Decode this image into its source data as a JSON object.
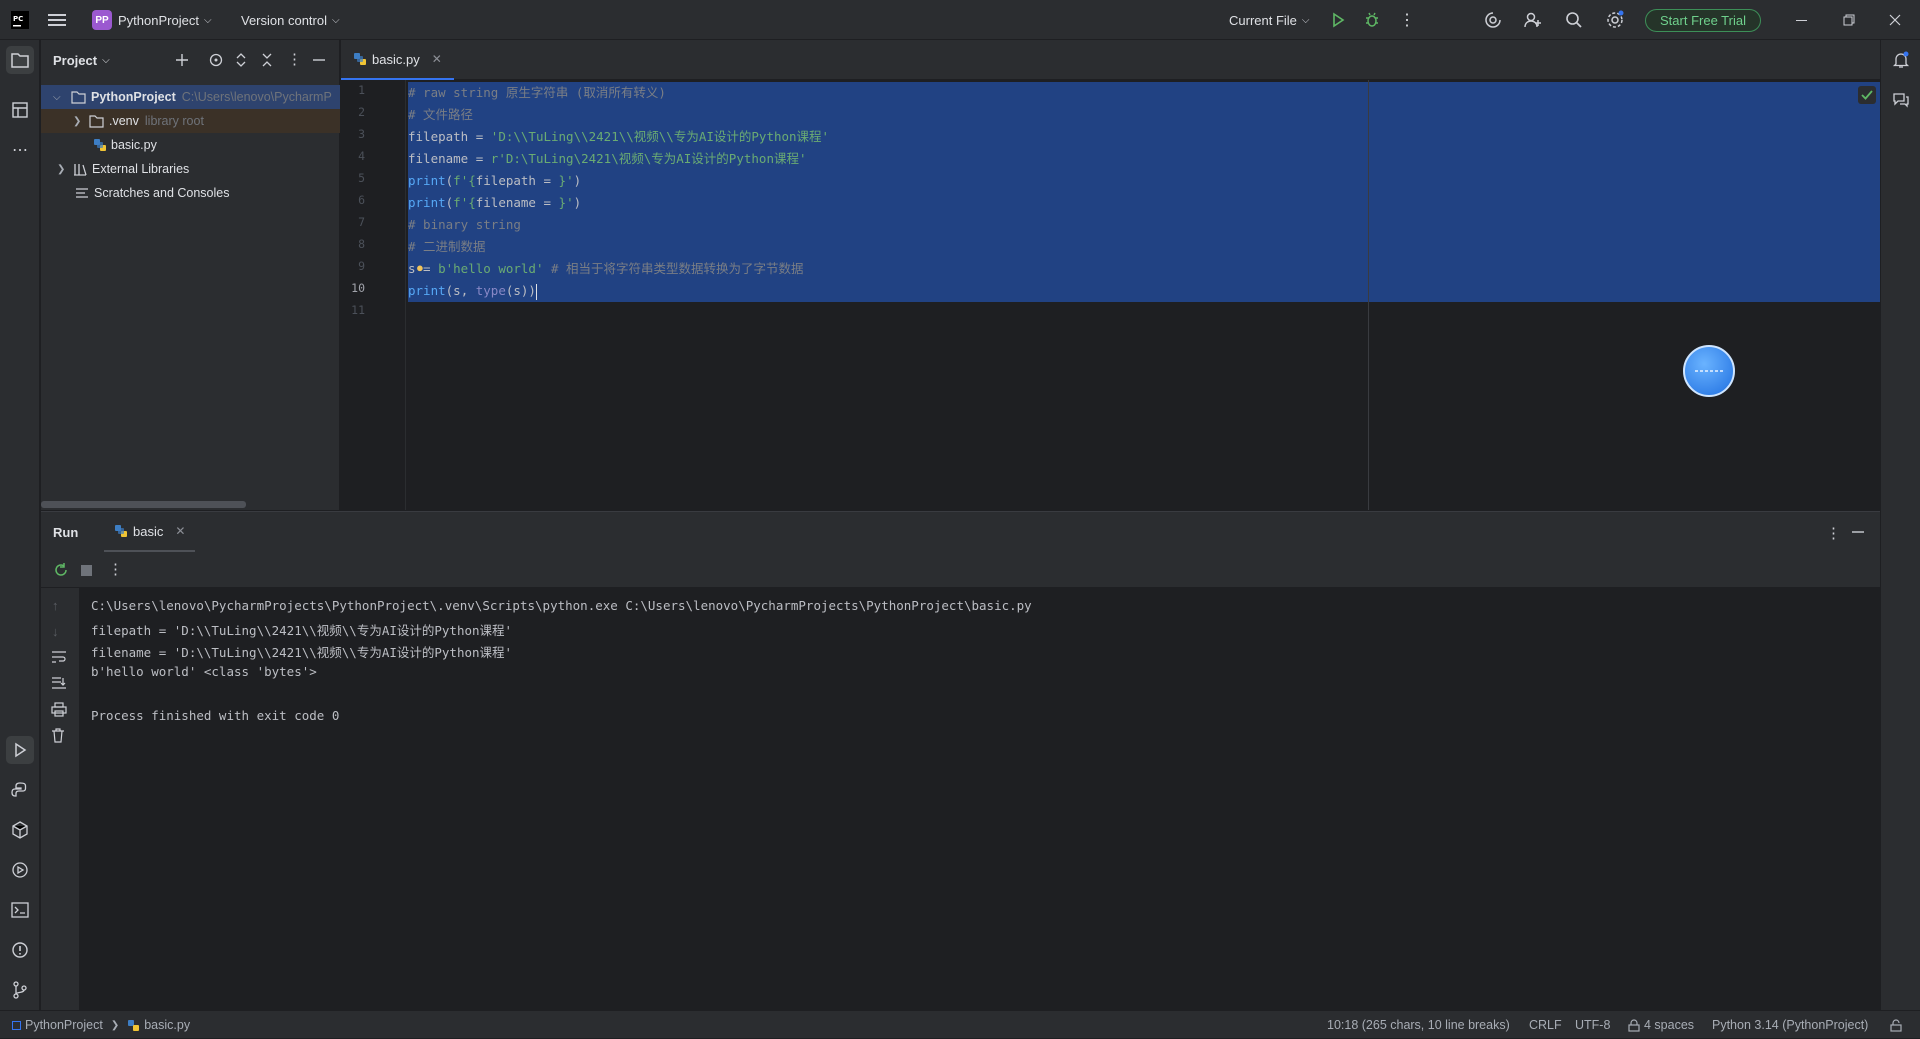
{
  "titlebar": {
    "project_initials": "PP",
    "project_name": "PythonProject",
    "vcs": "Version control",
    "run_config": "Current File",
    "trial_label": "Start Free Trial"
  },
  "project_panel": {
    "title": "Project",
    "tree": [
      {
        "label": "PythonProject",
        "hint": "C:\\Users\\lenovo\\PycharmP"
      },
      {
        "label": ".venv",
        "hint": "library root"
      },
      {
        "label": "basic.py",
        "hint": ""
      },
      {
        "label": "External Libraries",
        "hint": ""
      },
      {
        "label": "Scratches and Consoles",
        "hint": ""
      }
    ]
  },
  "editor": {
    "tab_label": "basic.py",
    "line_numbers": [
      "1",
      "2",
      "3",
      "4",
      "5",
      "6",
      "7",
      "8",
      "9",
      "10",
      "11"
    ],
    "code": {
      "l1": "# raw string 原生字符串 (取消所有转义)",
      "l2": "# 文件路径",
      "l3_var": "filepath",
      "l3_op": " = ",
      "l3_str": "'D:\\\\TuLing\\\\2421\\\\视频\\\\专为AI设计的Python课程'",
      "l4_var": "filename",
      "l4_op": " = ",
      "l4_str": "r'D:\\TuLing\\2421\\视频\\专为AI设计的Python课程'",
      "l5_fn": "print",
      "l5_open": "(",
      "l5_str1": "f'{",
      "l5_var": "filepath = ",
      "l5_str2": "}'",
      "l5_close": ")",
      "l6_fn": "print",
      "l6_open": "(",
      "l6_str1": "f'{",
      "l6_var": "filename = ",
      "l6_str2": "}'",
      "l6_close": ")",
      "l7": "# binary string",
      "l8": "# 二进制数据",
      "l9_var": "s",
      "l9_op": " = ",
      "l9_str": "b'hello world'",
      "l9_com": " # 相当于将字符串类型数据转换为了字节数据",
      "l10_fn": "print",
      "l10_open": "(s, ",
      "l10_bi": "type",
      "l10_close": "(s))"
    }
  },
  "run_panel": {
    "title": "Run",
    "tab_label": "basic",
    "output": [
      "C:\\Users\\lenovo\\PycharmProjects\\PythonProject\\.venv\\Scripts\\python.exe C:\\Users\\lenovo\\PycharmProjects\\PythonProject\\basic.py",
      "filepath = 'D:\\\\TuLing\\\\2421\\\\视频\\\\专为AI设计的Python课程'",
      "filename = 'D:\\\\TuLing\\\\2421\\\\视频\\\\专为AI设计的Python课程'",
      "b'hello world' <class 'bytes'>",
      "",
      "Process finished with exit code 0"
    ]
  },
  "statusbar": {
    "crumb_project": "PythonProject",
    "crumb_file": "basic.py",
    "position": "10:18 (265 chars, 10 line breaks)",
    "line_sep": "CRLF",
    "encoding": "UTF-8",
    "indent": "4 spaces",
    "interpreter": "Python 3.14 (PythonProject)"
  },
  "colors": {
    "accent": "#3574f0",
    "selection": "#214283",
    "string": "#6aab73",
    "comment": "#7a7e85",
    "trial_green": "#6fd08c"
  }
}
